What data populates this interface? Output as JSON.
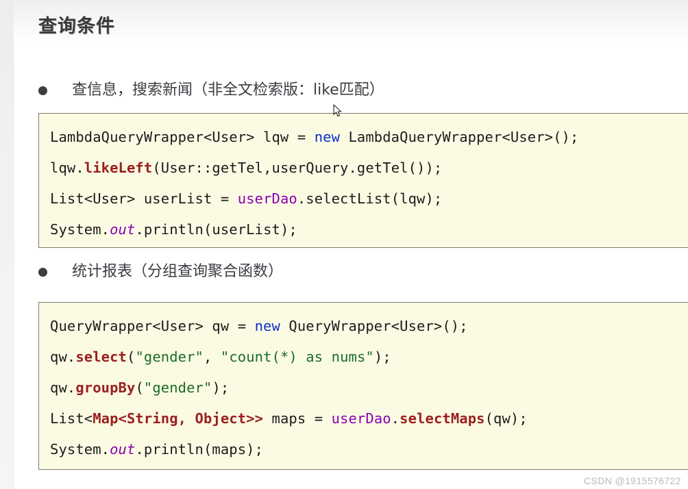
{
  "page": {
    "title": "查询条件",
    "watermark": "CSDN @1915576722"
  },
  "sections": [
    {
      "bullet": "查信息，搜索新闻（非全文检索版：like匹配）",
      "code": [
        {
          "tokens": [
            {
              "t": "LambdaQueryWrapper<User> lqw = ",
              "c": "plain"
            },
            {
              "t": "new",
              "c": "kw"
            },
            {
              "t": " LambdaQueryWrapper<User>();",
              "c": "plain"
            }
          ],
          "text": "LambdaQueryWrapper<User> lqw = new LambdaQueryWrapper<User>();"
        },
        {
          "tokens": [
            {
              "t": "lqw.",
              "c": "plain"
            },
            {
              "t": "likeLeft",
              "c": "method"
            },
            {
              "t": "(User::getTel,userQuery.getTel());",
              "c": "plain"
            }
          ],
          "text": "lqw.likeLeft(User::getTel,userQuery.getTel());"
        },
        {
          "tokens": [
            {
              "t": "List<User> userList = ",
              "c": "plain"
            },
            {
              "t": "userDao",
              "c": "var"
            },
            {
              "t": ".selectList(lqw);",
              "c": "plain"
            }
          ],
          "text": "List<User> userList = userDao.selectList(lqw);"
        },
        {
          "tokens": [
            {
              "t": "System.",
              "c": "plain"
            },
            {
              "t": "out",
              "c": "field"
            },
            {
              "t": ".println(userList);",
              "c": "plain"
            }
          ],
          "text": "System.out.println(userList);"
        }
      ]
    },
    {
      "bullet": "统计报表（分组查询聚合函数）",
      "code": [
        {
          "tokens": [
            {
              "t": "QueryWrapper<User> qw = ",
              "c": "plain"
            },
            {
              "t": "new",
              "c": "kw"
            },
            {
              "t": " QueryWrapper<User>();",
              "c": "plain"
            }
          ],
          "text": "QueryWrapper<User> qw = new QueryWrapper<User>();"
        },
        {
          "tokens": [
            {
              "t": "qw.",
              "c": "plain"
            },
            {
              "t": "select",
              "c": "method"
            },
            {
              "t": "(",
              "c": "plain"
            },
            {
              "t": "\"gender\"",
              "c": "str"
            },
            {
              "t": ", ",
              "c": "plain"
            },
            {
              "t": "\"count(*) as nums\"",
              "c": "str"
            },
            {
              "t": ");",
              "c": "plain"
            }
          ],
          "text": "qw.select(\"gender\", \"count(*) as nums\");"
        },
        {
          "tokens": [
            {
              "t": "qw.",
              "c": "plain"
            },
            {
              "t": "groupBy",
              "c": "method"
            },
            {
              "t": "(",
              "c": "plain"
            },
            {
              "t": "\"gender\"",
              "c": "str"
            },
            {
              "t": ");",
              "c": "plain"
            }
          ],
          "text": "qw.groupBy(\"gender\");"
        },
        {
          "tokens": [
            {
              "t": "List<",
              "c": "plain"
            },
            {
              "t": "Map<String, Object>>",
              "c": "type"
            },
            {
              "t": " maps = ",
              "c": "plain"
            },
            {
              "t": "userDao",
              "c": "var"
            },
            {
              "t": ".",
              "c": "plain"
            },
            {
              "t": "selectMaps",
              "c": "method"
            },
            {
              "t": "(qw);",
              "c": "plain"
            }
          ],
          "text": "List<Map<String, Object>> maps = userDao.selectMaps(qw);"
        },
        {
          "tokens": [
            {
              "t": "System.",
              "c": "plain"
            },
            {
              "t": "out",
              "c": "field"
            },
            {
              "t": ".println(maps);",
              "c": "plain"
            }
          ],
          "text": "System.out.println(maps);"
        }
      ]
    }
  ],
  "colors": {
    "code_background": "#fbfbe4",
    "code_border": "#7e7a6e",
    "keyword": "#0b2ec9",
    "method": "#9a1f1f",
    "variable": "#8a00b0",
    "string": "#1b6b28",
    "text": "#3b3b42"
  }
}
